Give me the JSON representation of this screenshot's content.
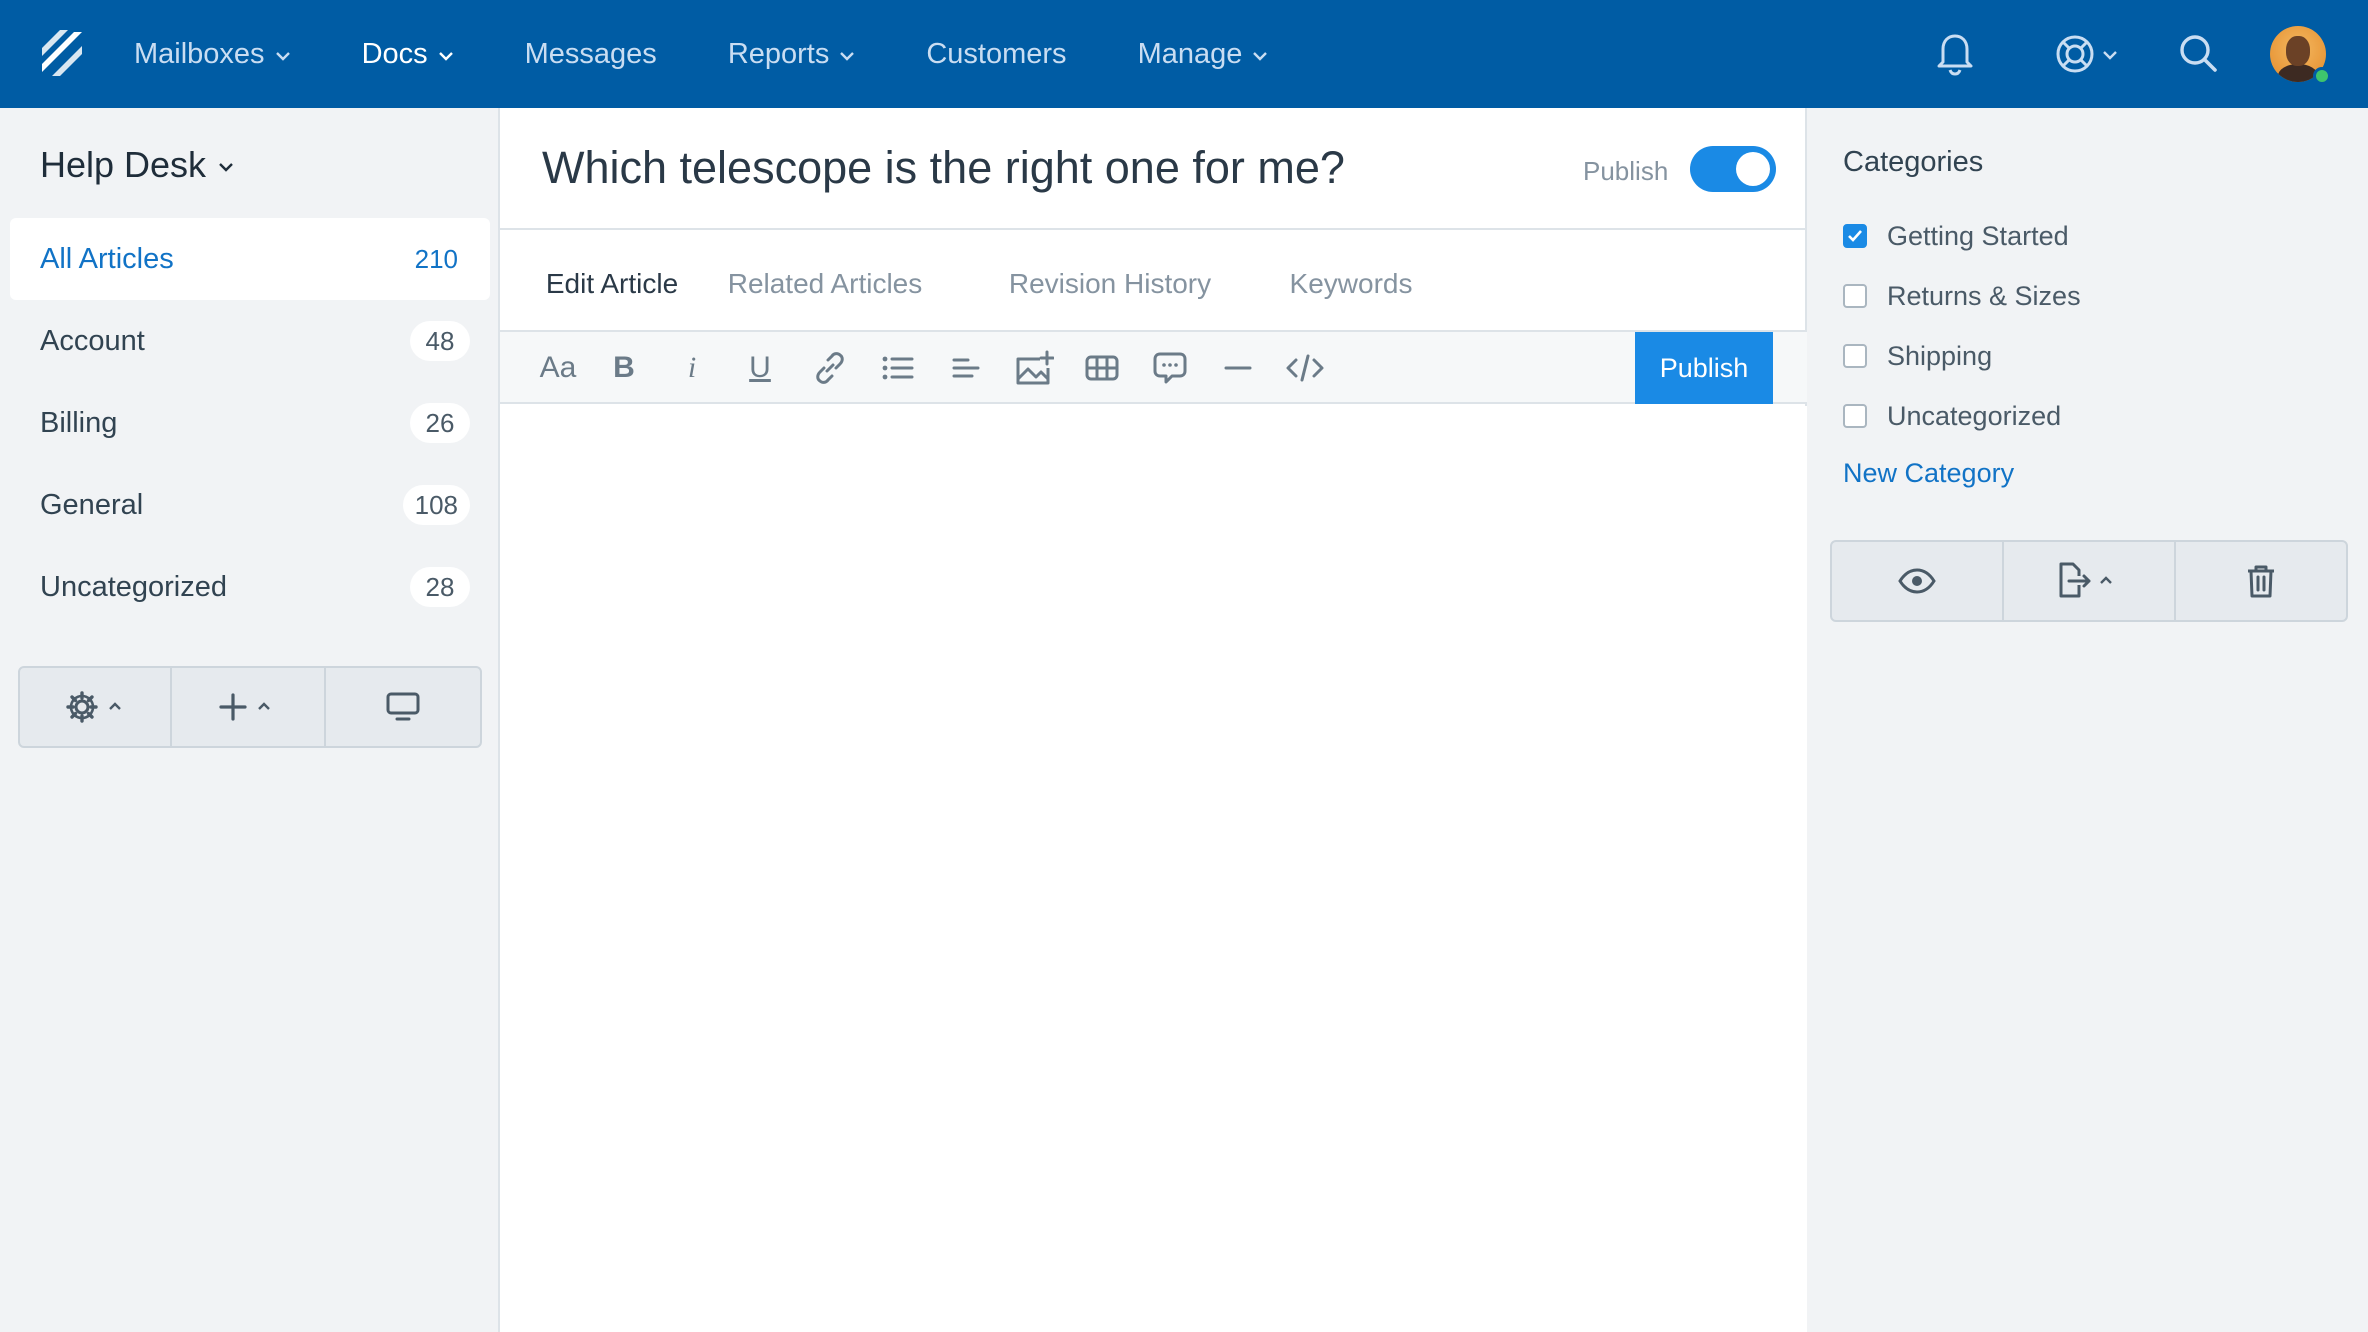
{
  "nav": {
    "items": [
      {
        "label": "Mailboxes",
        "dropdown": true,
        "active": false
      },
      {
        "label": "Docs",
        "dropdown": true,
        "active": true
      },
      {
        "label": "Messages",
        "dropdown": false,
        "active": false
      },
      {
        "label": "Reports",
        "dropdown": true,
        "active": false
      },
      {
        "label": "Customers",
        "dropdown": false,
        "active": false
      },
      {
        "label": "Manage",
        "dropdown": true,
        "active": false
      }
    ],
    "icons": [
      "logo-icon",
      "bell-icon",
      "help-lifebuoy-icon",
      "search-icon",
      "avatar"
    ],
    "presence_color": "#3ec46d"
  },
  "sidebar": {
    "title": "Help Desk",
    "items": [
      {
        "label": "All Articles",
        "count": "210",
        "active": true
      },
      {
        "label": "Account",
        "count": "48",
        "active": false
      },
      {
        "label": "Billing",
        "count": "26",
        "active": false
      },
      {
        "label": "General",
        "count": "108",
        "active": false
      },
      {
        "label": "Uncategorized",
        "count": "28",
        "active": false
      }
    ],
    "actions": [
      "gear-icon",
      "plus-icon",
      "monitor-icon"
    ]
  },
  "article": {
    "title": "Which telescope is the right one for me?",
    "publish_label": "Publish",
    "published": true,
    "tabs": [
      {
        "label": "Edit Article",
        "active": true
      },
      {
        "label": "Related Articles",
        "active": false
      },
      {
        "label": "Revision History",
        "active": false
      },
      {
        "label": "Keywords",
        "active": false
      }
    ],
    "toolbar": {
      "font_label": "Aa",
      "bold_label": "B",
      "italic_label": "i",
      "underline_label": "U",
      "publish_button": "Publish"
    }
  },
  "categories": {
    "title": "Categories",
    "items": [
      {
        "label": "Getting Started",
        "checked": true
      },
      {
        "label": "Returns & Sizes",
        "checked": false
      },
      {
        "label": "Shipping",
        "checked": false
      },
      {
        "label": "Uncategorized",
        "checked": false
      }
    ],
    "new_label": "New Category",
    "actions": [
      "eye-icon",
      "export-icon",
      "trash-icon"
    ]
  },
  "colors": {
    "nav_bg": "#005ca4",
    "accent": "#1a8ae5",
    "link": "#1173c6"
  }
}
